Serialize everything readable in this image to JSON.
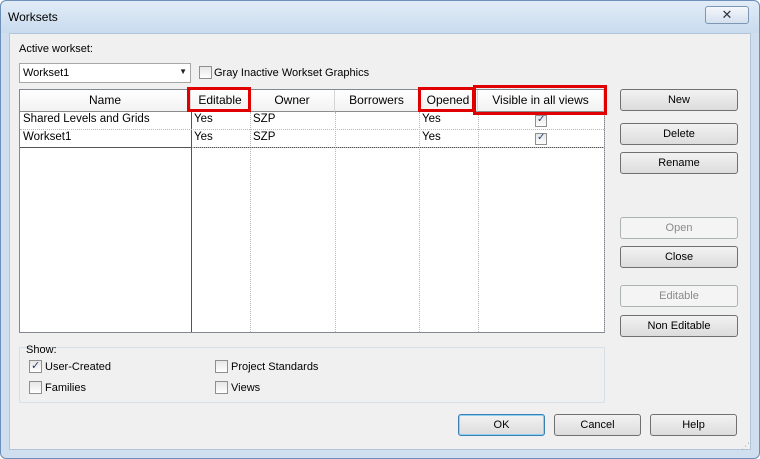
{
  "window": {
    "title": "Worksets",
    "close_glyph": "✕"
  },
  "active_workset": {
    "label": "Active workset:",
    "value": "Workset1"
  },
  "gray_inactive": {
    "label": "Gray Inactive Workset Graphics",
    "checked": false
  },
  "table": {
    "columns": [
      "Name",
      "Editable",
      "Owner",
      "Borrowers",
      "Opened",
      "Visible in all views"
    ],
    "rows": [
      {
        "name": "Shared Levels and Grids",
        "editable": "Yes",
        "owner": "SZP",
        "borrowers": "",
        "opened": "Yes",
        "visible": true
      },
      {
        "name": "Workset1",
        "editable": "Yes",
        "owner": "SZP",
        "borrowers": "",
        "opened": "Yes",
        "visible": true
      }
    ],
    "highlight_color": "#e00000"
  },
  "side_buttons": {
    "new": "New",
    "delete": "Delete",
    "rename": "Rename",
    "open": "Open",
    "close": "Close",
    "editable": "Editable",
    "non_editable": "Non Editable"
  },
  "show": {
    "label": "Show:",
    "user_created": {
      "label": "User-Created",
      "checked": true
    },
    "families": {
      "label": "Families",
      "checked": false
    },
    "project_standards": {
      "label": "Project Standards",
      "checked": false
    },
    "views": {
      "label": "Views",
      "checked": false
    }
  },
  "dialog_buttons": {
    "ok": "OK",
    "cancel": "Cancel",
    "help": "Help"
  },
  "icons": {
    "dropdown": "chevron-down-icon",
    "check": "✓",
    "resize_grip": "⋰"
  }
}
